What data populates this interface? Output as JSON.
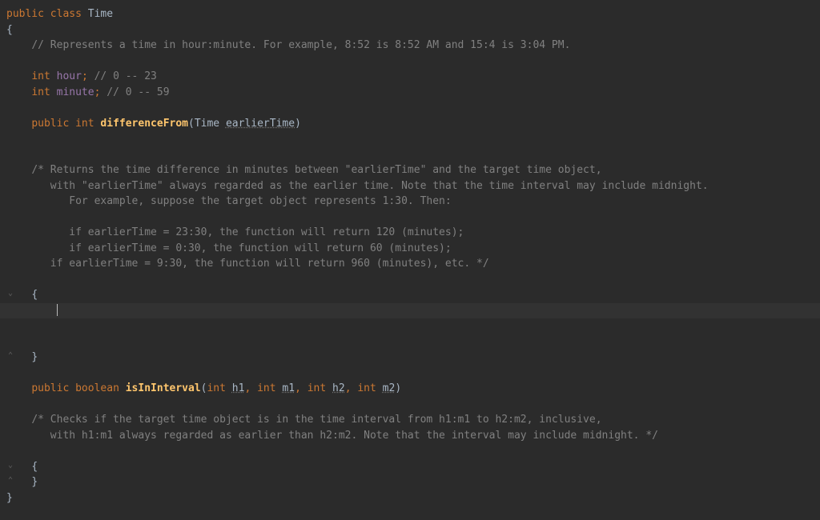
{
  "code": {
    "l1_public": "public",
    "l1_class": "class",
    "l1_name": "Time",
    "l2_brace": "{",
    "l3_comment": "// Represents a time in hour:minute. For example, 8:52 is 8:52 AM and 15:4 is 3:04 PM.",
    "l4_int": "int",
    "l4_field": "hour",
    "l4_semi": ";",
    "l4_comment": " // 0 -- 23",
    "l5_int": "int",
    "l5_field": "minute",
    "l5_semi": ";",
    "l5_comment": " // 0 -- 59",
    "l6_public": "public",
    "l6_int": "int",
    "l6_method": "differenceFrom",
    "l6_lparen": "(",
    "l6_type": "Time",
    "l6_param": "earlierTime",
    "l6_rparen": ")",
    "l7_c1": "/* Returns the time difference in minutes between \"earlierTime\" and the target time object,",
    "l7_c2": "   with \"earlierTime\" always regarded as the earlier time. Note that the time interval may include midnight.",
    "l7_c3": "      For example, suppose the target object represents 1:30. Then:",
    "l7_c4": "      if earlierTime = 23:30, the function will return 120 (minutes);",
    "l7_c5": "      if earlierTime = 0:30, the function will return 60 (minutes);",
    "l7_c6": "   if earlierTime = 9:30, the function will return 960 (minutes), etc. */",
    "l8_brace_open": "{",
    "l9_brace_close": "}",
    "l10_public": "public",
    "l10_boolean": "boolean",
    "l10_method": "isInInterval",
    "l10_lparen": "(",
    "l10_int1": "int",
    "l10_p1": "h1",
    "l10_c1": ",",
    "l10_int2": "int",
    "l10_p2": "m1",
    "l10_c2": ",",
    "l10_int3": "int",
    "l10_p3": "h2",
    "l10_c3": ",",
    "l10_int4": "int",
    "l10_p4": "m2",
    "l10_rparen": ")",
    "l11_c1": "/* Checks if the target time object is in the time interval from h1:m1 to h2:m2, inclusive,",
    "l11_c2": "   with h1:m1 always regarded as earlier than h2:m2. Note that the interval may include midnight. */",
    "l12_brace_open": "{",
    "l13_brace_close": "}",
    "l14_brace": "}"
  }
}
